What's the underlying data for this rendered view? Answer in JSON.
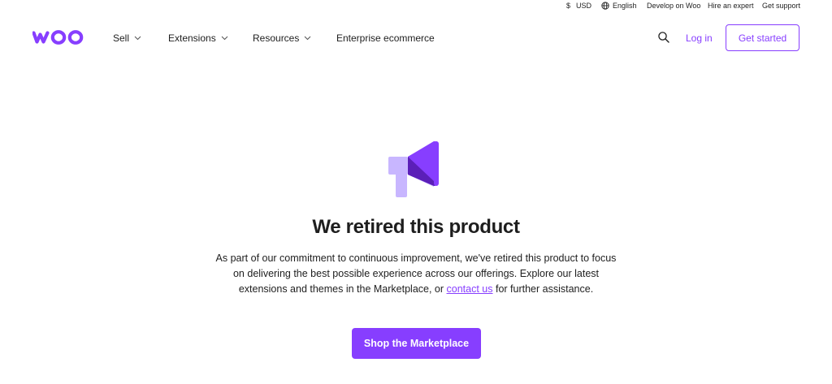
{
  "utility_bar": {
    "currency_symbol": "$",
    "currency": "USD",
    "language": "English",
    "develop": "Develop on Woo",
    "hire": "Hire an expert",
    "support": "Get support"
  },
  "nav": {
    "items": [
      {
        "label": "Sell",
        "has_dropdown": true
      },
      {
        "label": "Extensions",
        "has_dropdown": true
      },
      {
        "label": "Resources",
        "has_dropdown": true
      },
      {
        "label": "Enterprise ecommerce",
        "has_dropdown": false
      }
    ],
    "login": "Log in",
    "get_started": "Get started"
  },
  "hero": {
    "icon": "megaphone-icon",
    "title": "We retired this product",
    "description_before": "As part of our commitment to continuous improvement, we've retired this product to focus on delivering the best possible experience across our offerings. Explore our latest extensions and themes in the Marketplace, or ",
    "contact_link": "contact us",
    "description_after": " for further assistance.",
    "button": "Shop the Marketplace"
  },
  "colors": {
    "brand": "#873eff",
    "brand_dark": "#5b1fb8",
    "brand_light": "#c8b6ff",
    "text": "#1e1e1e"
  }
}
